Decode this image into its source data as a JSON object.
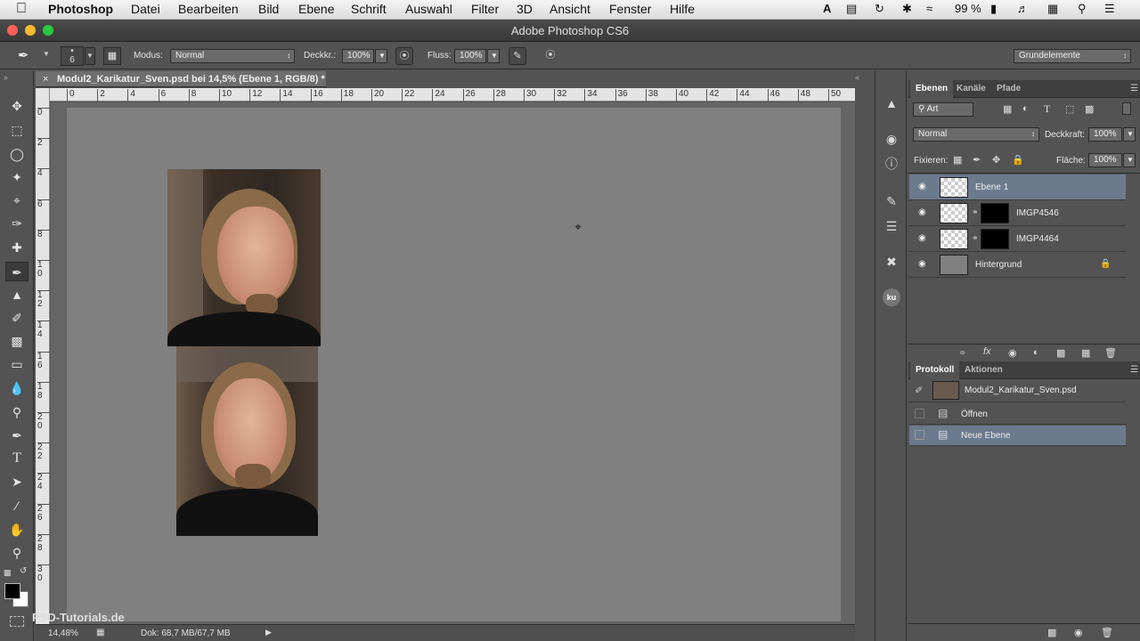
{
  "menubar": {
    "app_name": "Photoshop",
    "items": [
      "Datei",
      "Bearbeiten",
      "Bild",
      "Ebene",
      "Schrift",
      "Auswahl",
      "Filter",
      "3D",
      "Ansicht",
      "Fenster",
      "Hilfe"
    ],
    "battery": "99 %"
  },
  "window": {
    "title": "Adobe Photoshop CS6"
  },
  "options": {
    "brush_size": "6",
    "mode_label": "Modus:",
    "mode_value": "Normal",
    "opacity_label": "Deckkr.:",
    "opacity_value": "100%",
    "flow_label": "Fluss:",
    "flow_value": "100%",
    "workspace": "Grundelemente"
  },
  "document": {
    "tab_title": "Modul2_Karikatur_Sven.psd bei 14,5% (Ebene 1, RGB/8) *",
    "ruler_top": [
      "0",
      "2",
      "4",
      "6",
      "8",
      "10",
      "12",
      "14",
      "16",
      "18",
      "20",
      "22",
      "24",
      "26",
      "28",
      "30",
      "32",
      "34",
      "36",
      "38",
      "40",
      "42",
      "44",
      "46",
      "48",
      "50"
    ],
    "ruler_left": [
      "0",
      "2",
      "4",
      "6",
      "8",
      "1\n0",
      "1\n2",
      "1\n4",
      "1\n6",
      "1\n8",
      "2\n0",
      "2\n2",
      "2\n4",
      "2\n6",
      "2\n8",
      "3\n0"
    ]
  },
  "statusbar": {
    "zoom": "14,48%",
    "doc_info": "Dok: 68,7 MB/67,7 MB"
  },
  "watermark": "PSD-Tutorials.de",
  "layers_panel": {
    "tabs": [
      "Ebenen",
      "Kanäle",
      "Pfade"
    ],
    "filter_kind": "Art",
    "blend_mode": "Normal",
    "opacity_label": "Deckkraft:",
    "opacity_value": "100%",
    "lock_label": "Fixieren:",
    "fill_label": "Fläche:",
    "fill_value": "100%",
    "layers": [
      {
        "name": "Ebene 1",
        "selected": true
      },
      {
        "name": "IMGP4546",
        "selected": false
      },
      {
        "name": "IMGP4464",
        "selected": false
      },
      {
        "name": "Hintergrund",
        "selected": false
      }
    ]
  },
  "history_panel": {
    "tabs": [
      "Protokoll",
      "Aktionen"
    ],
    "snapshot": "Modul2_Karikatur_Sven.psd",
    "items": [
      {
        "name": "Öffnen",
        "selected": false
      },
      {
        "name": "Neue Ebene",
        "selected": true
      }
    ]
  },
  "colors": {
    "selection": "#6c7a8e",
    "panel": "#535353",
    "canvas": "#808080"
  }
}
